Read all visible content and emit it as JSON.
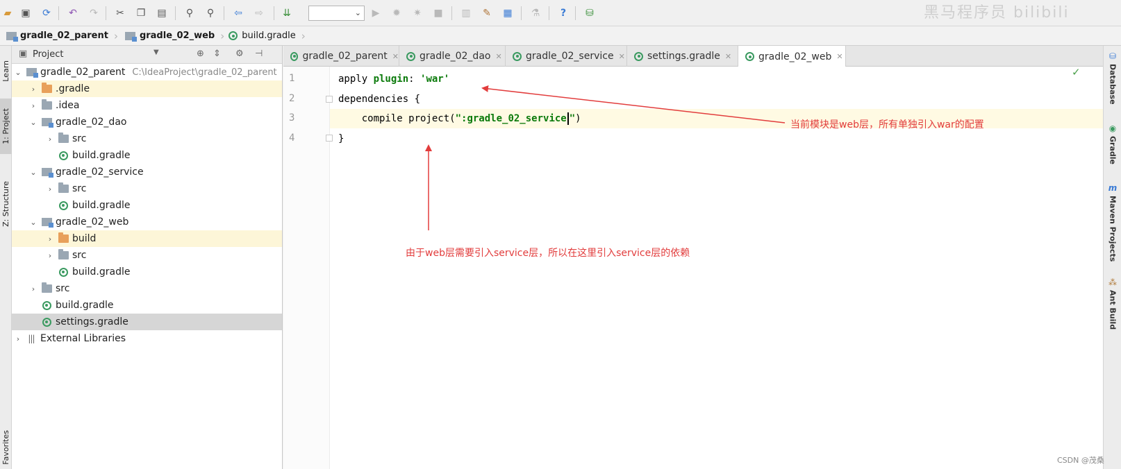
{
  "watermark": "黑马程序员 bilibili",
  "breadcrumb": [
    {
      "label": "gradle_02_parent"
    },
    {
      "label": "gradle_02_web"
    },
    {
      "label": "build.gradle"
    }
  ],
  "left_stripe": {
    "learn": "Learn",
    "project": "1: Project",
    "structure": "Z: Structure",
    "favorites": "Favorites"
  },
  "project_panel": {
    "title": "Project",
    "tree": [
      {
        "label": "gradle_02_parent",
        "path": "C:\\IdeaProject\\gradle_02_parent"
      },
      {
        "label": ".gradle"
      },
      {
        "label": ".idea"
      },
      {
        "label": "gradle_02_dao"
      },
      {
        "label": "src"
      },
      {
        "label": "build.gradle"
      },
      {
        "label": "gradle_02_service"
      },
      {
        "label": "src"
      },
      {
        "label": "build.gradle"
      },
      {
        "label": "gradle_02_web"
      },
      {
        "label": "build"
      },
      {
        "label": "src"
      },
      {
        "label": "build.gradle"
      },
      {
        "label": "src"
      },
      {
        "label": "build.gradle"
      },
      {
        "label": "settings.gradle"
      },
      {
        "label": "External Libraries"
      }
    ]
  },
  "tabs": [
    {
      "label": "gradle_02_parent"
    },
    {
      "label": "gradle_02_dao"
    },
    {
      "label": "gradle_02_service"
    },
    {
      "label": "settings.gradle"
    },
    {
      "label": "gradle_02_web"
    }
  ],
  "editor": {
    "line_numbers": [
      "1",
      "2",
      "3",
      "4"
    ],
    "line1": {
      "plain": "apply ",
      "kw": "plugin",
      "colon": ": ",
      "str": "'war'"
    },
    "line2": "dependencies {",
    "line3": {
      "plain": "    compile project(",
      "q1": "\"",
      "str": ":gradle_02_service",
      "q2": "\"",
      "end": ")"
    },
    "line4": "}"
  },
  "annotations": {
    "top": "当前模块是web层，所有单独引入war的配置",
    "bottom": "由于web层需要引入service层，所以在这里引入service层的依赖",
    "color": "#e23c3c"
  },
  "right_stripe": {
    "database": "Database",
    "gradle": "Gradle",
    "maven": "Maven Projects",
    "ant": "Ant Build"
  },
  "footer": {
    "csdn": "CSDN @茂桑"
  }
}
